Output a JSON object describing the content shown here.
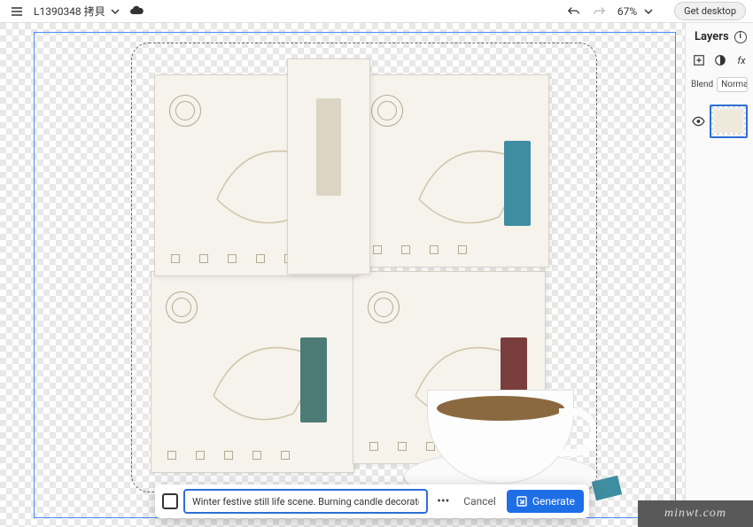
{
  "topbar": {
    "doc_title": "L1390348 拷貝",
    "zoom": "67%",
    "desktop_btn": "Get desktop"
  },
  "prompt": {
    "input_value": "Winter festive still life scene. Burning candle decorated by wooden",
    "cancel": "Cancel",
    "generate": "Generate"
  },
  "layers": {
    "title": "Layers",
    "blend_label": "Blend",
    "blend_value": "Normal"
  },
  "watermark": "minwt.com"
}
